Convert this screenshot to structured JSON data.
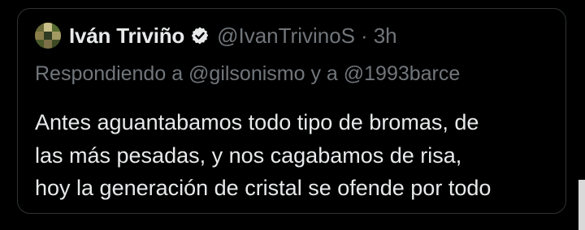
{
  "tweet": {
    "author": {
      "name": "Iván Triviño",
      "handle": "@IvanTrivinoS",
      "verified": true,
      "avatar_icon": "avatar-image"
    },
    "separator": "·",
    "time": "3h",
    "replying_to": "Respondiendo a @gilsonismo y a @1993barce",
    "text_lines": [
      "Antes aguantabamos todo tipo de bromas, de",
      "las más pesadas, y nos cagabamos de risa,",
      "hoy la generación de cristal se ofende por todo"
    ]
  },
  "colors": {
    "background": "#000000",
    "border": "#2f3336",
    "primary_text": "#e7e9ea",
    "secondary_text": "#71767b",
    "verified_badge": "#e7e9ea"
  }
}
